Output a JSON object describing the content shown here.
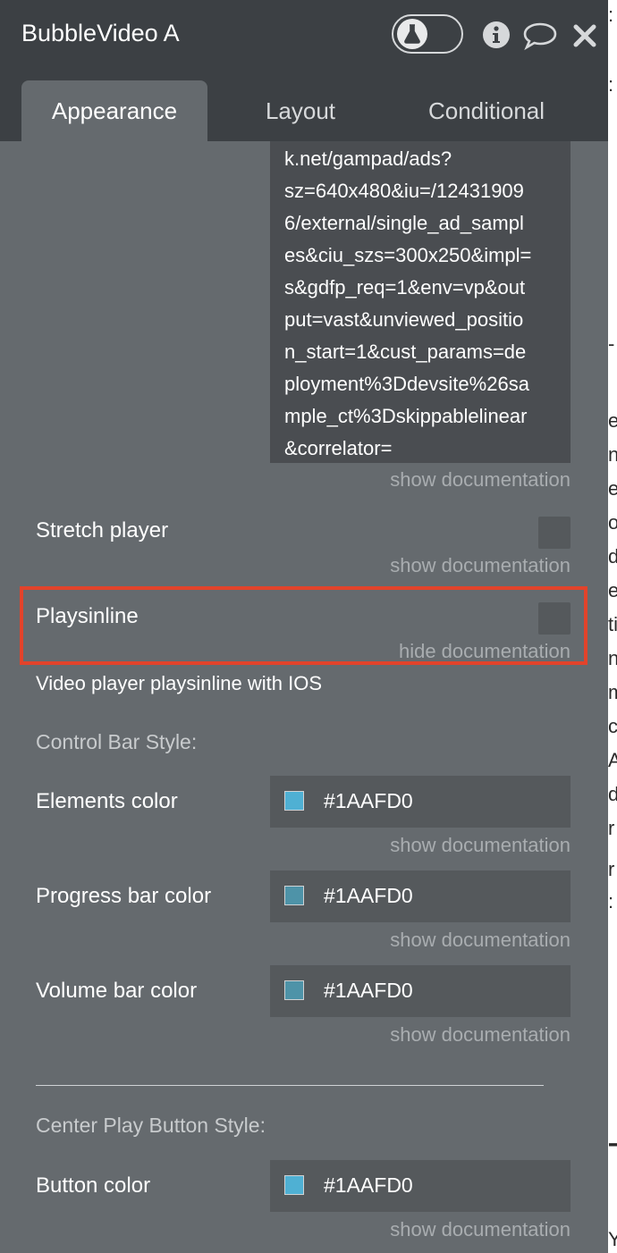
{
  "bg_fragments": [
    ":",
    ":",
    "-",
    "e",
    "n",
    "e",
    "o",
    "d",
    "e",
    "ti",
    "n",
    "m",
    "c",
    "A",
    "d",
    "r",
    "r",
    ":",
    "T",
    "Y"
  ],
  "header": {
    "title": "BubbleVideo A",
    "flask_icon": "flask-icon",
    "info_icon": "info-icon",
    "chat_icon": "chat-bubble-icon",
    "close_icon": "close-icon"
  },
  "tabs": [
    {
      "label": "Appearance",
      "active": true
    },
    {
      "label": "Layout",
      "active": false
    },
    {
      "label": "Conditional",
      "active": false
    }
  ],
  "ad_tag_url_lines": [
    "k.net/gampad/ads?",
    "sz=640x480&iu=/12431909",
    "6/external/single_ad_sampl",
    "es&ciu_szs=300x250&impl=",
    "s&gdfp_req=1&env=vp&out",
    "put=vast&unviewed_positio",
    "n_start=1&cust_params=de",
    "ployment%3Ddevsite%26sa",
    "mple_ct%3Dskippablelinear",
    "&correlator="
  ],
  "docs": {
    "show": "show documentation",
    "hide": "hide documentation"
  },
  "stretch_player": {
    "label": "Stretch player",
    "checked": false
  },
  "playsinline": {
    "label": "Playsinline",
    "checked": false,
    "documentation": "Video player playsinline with IOS"
  },
  "control_bar": {
    "section_title": "Control Bar Style:",
    "elements_color": {
      "label": "Elements color",
      "value": "#1AAFD0",
      "swatch": "#4fb0d3"
    },
    "progress_bar_color": {
      "label": "Progress bar color",
      "value": "#1AAFD0",
      "swatch": "#4e93a8"
    },
    "volume_bar_color": {
      "label": "Volume bar color",
      "value": "#1AAFD0",
      "swatch": "#4e93a8"
    }
  },
  "center_play": {
    "section_title": "Center Play Button Style:",
    "button_color": {
      "label": "Button color",
      "value": "#1AAFD0",
      "swatch": "#4fb0d3"
    }
  }
}
